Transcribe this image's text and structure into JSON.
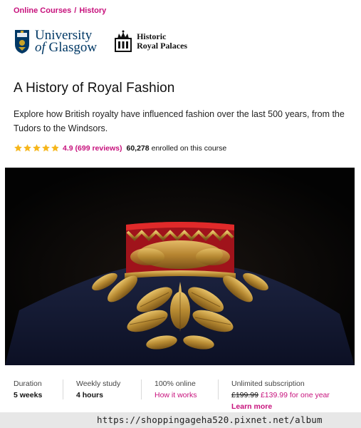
{
  "breadcrumb": {
    "item1": "Online Courses",
    "separator": "/",
    "item2": "History"
  },
  "partners": {
    "uog": {
      "line1": "University",
      "line2_of": "of",
      "line2_name": "Glasgow",
      "icon": "shield-crest-icon"
    },
    "hrp": {
      "line1": "Historic",
      "line2": "Royal Palaces",
      "icon": "crown-icon"
    }
  },
  "course": {
    "title": "A History of Royal Fashion",
    "description": "Explore how British royalty have influenced fashion over the last 500 years, from the Tudors to the Windsors.",
    "rating": "4.9 (699 reviews)",
    "rating_value": 4.9,
    "enrolled_count": "60,278",
    "enrolled_text": "enrolled on this course"
  },
  "hero": {
    "alt": "Gold embroidered royal collar"
  },
  "stats": {
    "duration": {
      "label": "Duration",
      "value": "5 weeks"
    },
    "weekly": {
      "label": "Weekly study",
      "value": "4 hours"
    },
    "online": {
      "label": "100% online",
      "link": "How it works"
    },
    "subscription": {
      "label": "Unlimited subscription",
      "old_price": "£199.99",
      "new_price": "£139.99 for one year",
      "more": "Learn more"
    }
  },
  "watermark": "https://shoppingageha520.pixnet.net/album",
  "colors": {
    "accent": "#c7117c",
    "star": "#f6b61b",
    "uog_blue": "#003865"
  }
}
